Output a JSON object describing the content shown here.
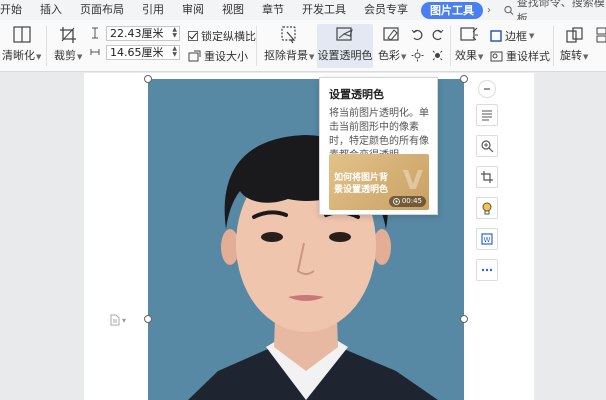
{
  "menu": {
    "tabs": [
      "开始",
      "插入",
      "页面布局",
      "引用",
      "审阅",
      "视图",
      "章节",
      "开发工具",
      "会员专享"
    ],
    "active_tab": "图片工具",
    "search_placeholder": "查找命令、搜索模板"
  },
  "ribbon": {
    "sharpen_label": "清晰化",
    "crop_label": "裁剪",
    "width_value": "22.43厘米",
    "height_value": "14.65厘米",
    "lock_ratio_label": "锁定纵横比",
    "lock_ratio_checked": true,
    "reset_size_label": "重设大小",
    "remove_bg_label": "抠除背景",
    "set_transparent_label": "设置透明色",
    "color_label": "色彩",
    "effects_label": "效果",
    "border_label": "边框",
    "reset_style_label": "重设样式",
    "rotate_label": "旋转"
  },
  "tooltip": {
    "title": "设置透明色",
    "description": "将当前图片透明化。单击当前图形中的像素时，特定颜色的所有像素都会变得透明。",
    "video_caption": "如何将图片背景设置透明色",
    "video_duration": "00:45"
  },
  "colors": {
    "accent": "#4a7ff0",
    "photo_background": "#5789a4"
  }
}
